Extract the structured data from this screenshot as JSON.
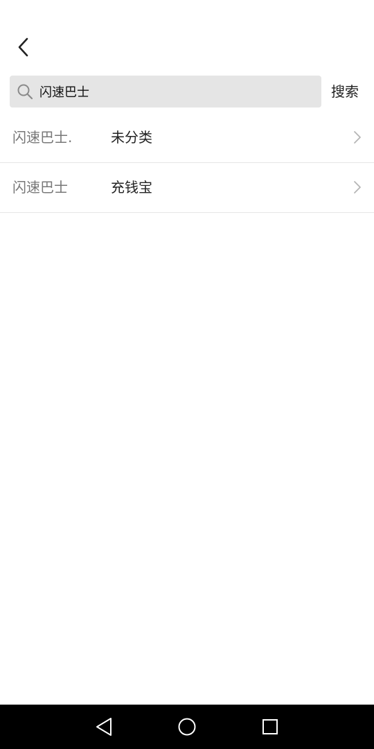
{
  "header": {
    "back_icon": "chevron-left-icon"
  },
  "search": {
    "icon": "search-icon",
    "value": "闪速巴士",
    "button_label": "搜索"
  },
  "results": [
    {
      "name": "闪速巴士.",
      "category": "未分类"
    },
    {
      "name": "闪速巴士",
      "category": "充钱宝"
    }
  ],
  "nav_bar": {
    "back_icon": "triangle-back-icon",
    "home_icon": "circle-home-icon",
    "recents_icon": "square-recents-icon"
  }
}
